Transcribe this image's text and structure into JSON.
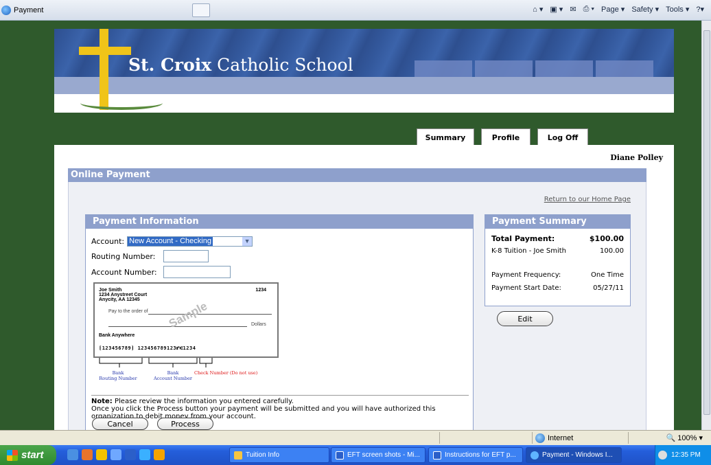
{
  "browser": {
    "tab_title": "Payment",
    "command_bar": [
      "Page ▾",
      "Safety ▾",
      "Tools ▾"
    ]
  },
  "site": {
    "school_name_bold": "St. Croix",
    "school_name_rest": "Catholic School",
    "tabs": [
      "Summary",
      "Profile",
      "Log Off"
    ],
    "user_name": "Diane Polley"
  },
  "page": {
    "title": "Online Payment",
    "home_link": "Return to our Home Page"
  },
  "payment_info": {
    "header": "Payment Information",
    "account_label": "Account:",
    "account_selected": "New Account - Checking",
    "routing_label": "Routing Number:",
    "routing_value": "",
    "account_number_label": "Account Number:",
    "account_number_value": "",
    "check": {
      "name": "Joe Smith",
      "address1": "1234 Anystreet Court",
      "address2": "Anycity, AA 12345",
      "number": "1234",
      "pay_to": "Pay to the order of",
      "dollars": "Dollars",
      "bank": "Bank Anywhere",
      "micr": "⁅123456789⁆ 123456789123⑈⑆1234",
      "watermark": "Sample"
    },
    "labels": {
      "routing": "Bank\nRouting Number",
      "account": "Bank\nAccount Number",
      "check_number": "Check Number (Do not use)"
    },
    "note_bold": "Note:",
    "note_text": " Please review the information you entered carefully.",
    "note_text2": "Once you click the Process button your payment will be submitted and you will have authorized this organization to debit money from your account.",
    "cancel_label": "Cancel",
    "process_label": "Process"
  },
  "summary": {
    "header": "Payment Summary",
    "total_label": "Total Payment:",
    "total_value": "$100.00",
    "item_label": "K-8 Tuition - Joe Smith",
    "item_value": "100.00",
    "frequency_label": "Payment Frequency:",
    "frequency_value": "One Time",
    "start_label": "Payment Start Date:",
    "start_value": "05/27/11",
    "edit_label": "Edit"
  },
  "status_bar": {
    "zone": "Internet",
    "zoom": "100%"
  },
  "taskbar": {
    "start": "start",
    "tasks": [
      "Tuition Info",
      "EFT screen shots - Mi...",
      "Instructions for EFT p...",
      "Payment - Windows I..."
    ],
    "clock": "12:35 PM"
  }
}
